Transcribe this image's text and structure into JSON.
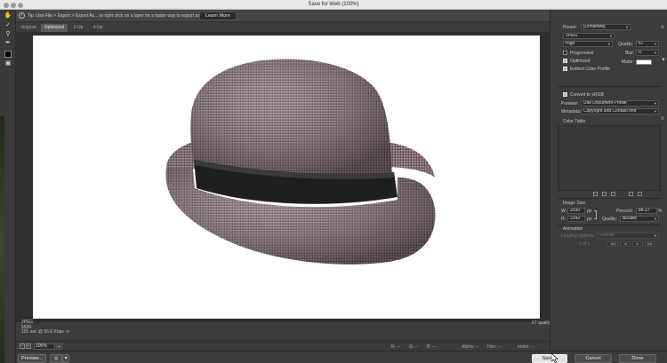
{
  "window": {
    "title": "Save for Web (100%)"
  },
  "tip": {
    "text": "Tip: Use File > Export > Export As... or right click on a layer for a faster way to export assets",
    "learn_more": "Learn More"
  },
  "tabs": [
    "Original",
    "Optimized",
    "2-Up",
    "4-Up"
  ],
  "image_info": {
    "format": "JPEG",
    "size": "553K",
    "time": "101 sec @ 56.6 Kbps",
    "time_icon": "-≡",
    "quality": "67 quality"
  },
  "zoom": {
    "value": "100%"
  },
  "readouts": {
    "r": "R: --",
    "g": "G: --",
    "b": "B: --",
    "alpha": "Alpha: --",
    "hex": "Hex: --",
    "index": "Index: --"
  },
  "buttons": {
    "preview": "Preview...",
    "save": "Save...",
    "cancel": "Cancel",
    "done": "Done"
  },
  "panel": {
    "preset_label": "Preset:",
    "preset_value": "[Unnamed]",
    "format_value": "JPEG",
    "quality_level": "High",
    "quality_label": "Quality:",
    "quality_value": "67",
    "progressive": "Progressive",
    "blur_label": "Blur:",
    "blur_value": "0",
    "optimized": "Optimized",
    "matte_label": "Matte:",
    "embed_profile": "Embed Color Profile",
    "convert_srgb": "Convert to sRGB",
    "preview_label": "Preview:",
    "preview_value": "Use Document Profile",
    "metadata_label": "Metadata:",
    "metadata_value": "Copyright and Contact Info",
    "color_table": "Color Table",
    "image_size": "Image Size",
    "w_label": "W:",
    "w_value": "2930",
    "h_label": "H:",
    "h_value": "2342",
    "px": "px",
    "percent_label": "Percent:",
    "percent_value": "84.27",
    "percent_unit": "%",
    "quality2_label": "Quality:",
    "quality2_value": "Bicubic",
    "animation": "Animation",
    "looping_label": "Looping Options:",
    "looping_value": "Forever",
    "frame_count": "1 of 1"
  },
  "colors": {
    "matte": "#ffffff",
    "canvas": "#ffffff",
    "panel": "#3c3c3c"
  }
}
